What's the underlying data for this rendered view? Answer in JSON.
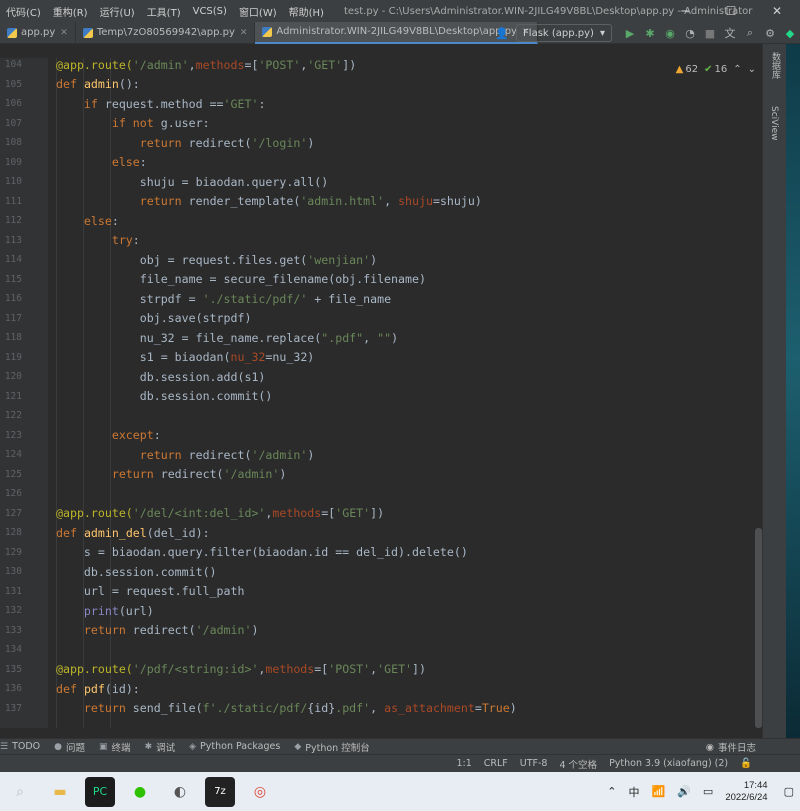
{
  "menu": [
    "代码(C)",
    "重构(R)",
    "运行(U)",
    "工具(T)",
    "VCS(S)",
    "窗口(W)",
    "帮助(H)"
  ],
  "window_title": "test.py - C:\\Users\\Administrator.WIN-2JILG49V8BL\\Desktop\\app.py - Administrator",
  "tabs": [
    {
      "label": "app.py",
      "active": false
    },
    {
      "label": "Temp\\7zO80569942\\app.py",
      "active": false
    },
    {
      "label": "Administrator.WIN-2JILG49V8BL\\Desktop\\app.py",
      "active": true
    }
  ],
  "run_config": "Flask (app.py)",
  "inspections": {
    "warnings": "62",
    "ok": "16"
  },
  "side_tabs": [
    "数据库",
    "SciView"
  ],
  "tool_windows": [
    {
      "icon": "todo-icon",
      "glyph": "☰",
      "label": "TODO"
    },
    {
      "icon": "problems-icon",
      "glyph": "●",
      "label": "问题"
    },
    {
      "icon": "terminal-icon",
      "glyph": "▣",
      "label": "终端"
    },
    {
      "icon": "debug-icon",
      "glyph": "✱",
      "label": "调试"
    },
    {
      "icon": "python-packages-icon",
      "glyph": "◈",
      "label": "Python Packages"
    },
    {
      "icon": "python-console-icon",
      "glyph": "◆",
      "label": "Python 控制台"
    }
  ],
  "event_log": "事件日志",
  "status": {
    "position": "1:1",
    "line_sep": "CRLF",
    "encoding": "UTF-8",
    "indent": "4 个空格",
    "interpreter": "Python 3.9 (xiaofang) (2)"
  },
  "taskbar": {
    "ime": "中",
    "time": "17:44",
    "date": "2022/6/24"
  },
  "code_lines": [
    {
      "n": "104",
      "html": "<span class=\"dec\">@app.route(</span><span class=\"str\">'/admin'</span>,<span class=\"param\">methods</span>=[<span class=\"str\">'POST'</span>,<span class=\"str\">'GET'</span>])"
    },
    {
      "n": "105",
      "html": "<span class=\"kw\">def</span> <span class=\"fn\">admin</span>():"
    },
    {
      "n": "106",
      "html": "    <span class=\"kw\">if</span> request.method ==<span class=\"str\">'GET'</span>:"
    },
    {
      "n": "107",
      "html": "        <span class=\"kw\">if not</span> g.user:"
    },
    {
      "n": "108",
      "html": "            <span class=\"kw\">return</span> redirect(<span class=\"str\">'/login'</span>)"
    },
    {
      "n": "109",
      "html": "        <span class=\"kw\">else</span>:"
    },
    {
      "n": "110",
      "html": "            shuju = biaodan.query.all()"
    },
    {
      "n": "111",
      "html": "            <span class=\"kw\">return</span> render_template(<span class=\"str\">'admin.html'</span>, <span class=\"param\">shuju</span>=shuju)"
    },
    {
      "n": "112",
      "html": "    <span class=\"kw\">else</span>:"
    },
    {
      "n": "113",
      "html": "        <span class=\"kw\">try</span>:"
    },
    {
      "n": "114",
      "html": "            obj = request.files.get(<span class=\"str\">'wenjian'</span>)"
    },
    {
      "n": "115",
      "html": "            file_name = secure_filename(obj.filename)"
    },
    {
      "n": "116",
      "html": "            strpdf = <span class=\"str\">'./static/pdf/'</span> + file_name"
    },
    {
      "n": "117",
      "html": "            obj.save(strpdf)"
    },
    {
      "n": "118",
      "html": "            nu_32 = file_name.replace(<span class=\"str\">\".pdf\"</span>, <span class=\"str\">\"\"</span>)"
    },
    {
      "n": "119",
      "html": "            s1 = biaodan(<span class=\"param\">nu_32</span>=nu_32)"
    },
    {
      "n": "120",
      "html": "            db.session.add(s1)"
    },
    {
      "n": "121",
      "html": "            db.session.commit()"
    },
    {
      "n": "122",
      "html": ""
    },
    {
      "n": "123",
      "html": "        <span class=\"kw\">except</span>:"
    },
    {
      "n": "124",
      "html": "            <span class=\"kw\">return</span> redirect(<span class=\"str\">'/admin'</span>)"
    },
    {
      "n": "125",
      "html": "        <span class=\"kw\">return</span> redirect(<span class=\"str\">'/admin'</span>)"
    },
    {
      "n": "126",
      "html": ""
    },
    {
      "n": "127",
      "html": "<span class=\"dec\">@app.route(</span><span class=\"str\">'/del/&lt;int:del_id&gt;'</span>,<span class=\"param\">methods</span>=[<span class=\"str\">'GET'</span>])"
    },
    {
      "n": "128",
      "html": "<span class=\"kw\">def</span> <span class=\"fn\">admin_del</span>(del_id):"
    },
    {
      "n": "129",
      "html": "    s = biaodan.query.filter(biaodan.id == del_id).delete()"
    },
    {
      "n": "130",
      "html": "    db.session.commit()"
    },
    {
      "n": "131",
      "html": "    url = request.full_path"
    },
    {
      "n": "132",
      "html": "    <span class=\"builtin\">print</span>(url)"
    },
    {
      "n": "133",
      "html": "    <span class=\"kw\">return</span> redirect(<span class=\"str\">'/admin'</span>)"
    },
    {
      "n": "134",
      "html": ""
    },
    {
      "n": "135",
      "html": "<span class=\"dec\">@app.route(</span><span class=\"str\">'/pdf/&lt;string:id&gt;'</span>,<span class=\"param\">methods</span>=[<span class=\"str\">'POST'</span>,<span class=\"str\">'GET'</span>])"
    },
    {
      "n": "136",
      "html": "<span class=\"kw\">def</span> <span class=\"fn\">pdf</span>(id):"
    },
    {
      "n": "137",
      "html": "    <span class=\"kw\">return</span> send_file(<span class=\"str\">f'./static/pdf/</span>{id}<span class=\"str\">.pdf'</span>, <span class=\"param\">as_attachment</span>=<span class=\"kw\">True</span>)"
    }
  ]
}
